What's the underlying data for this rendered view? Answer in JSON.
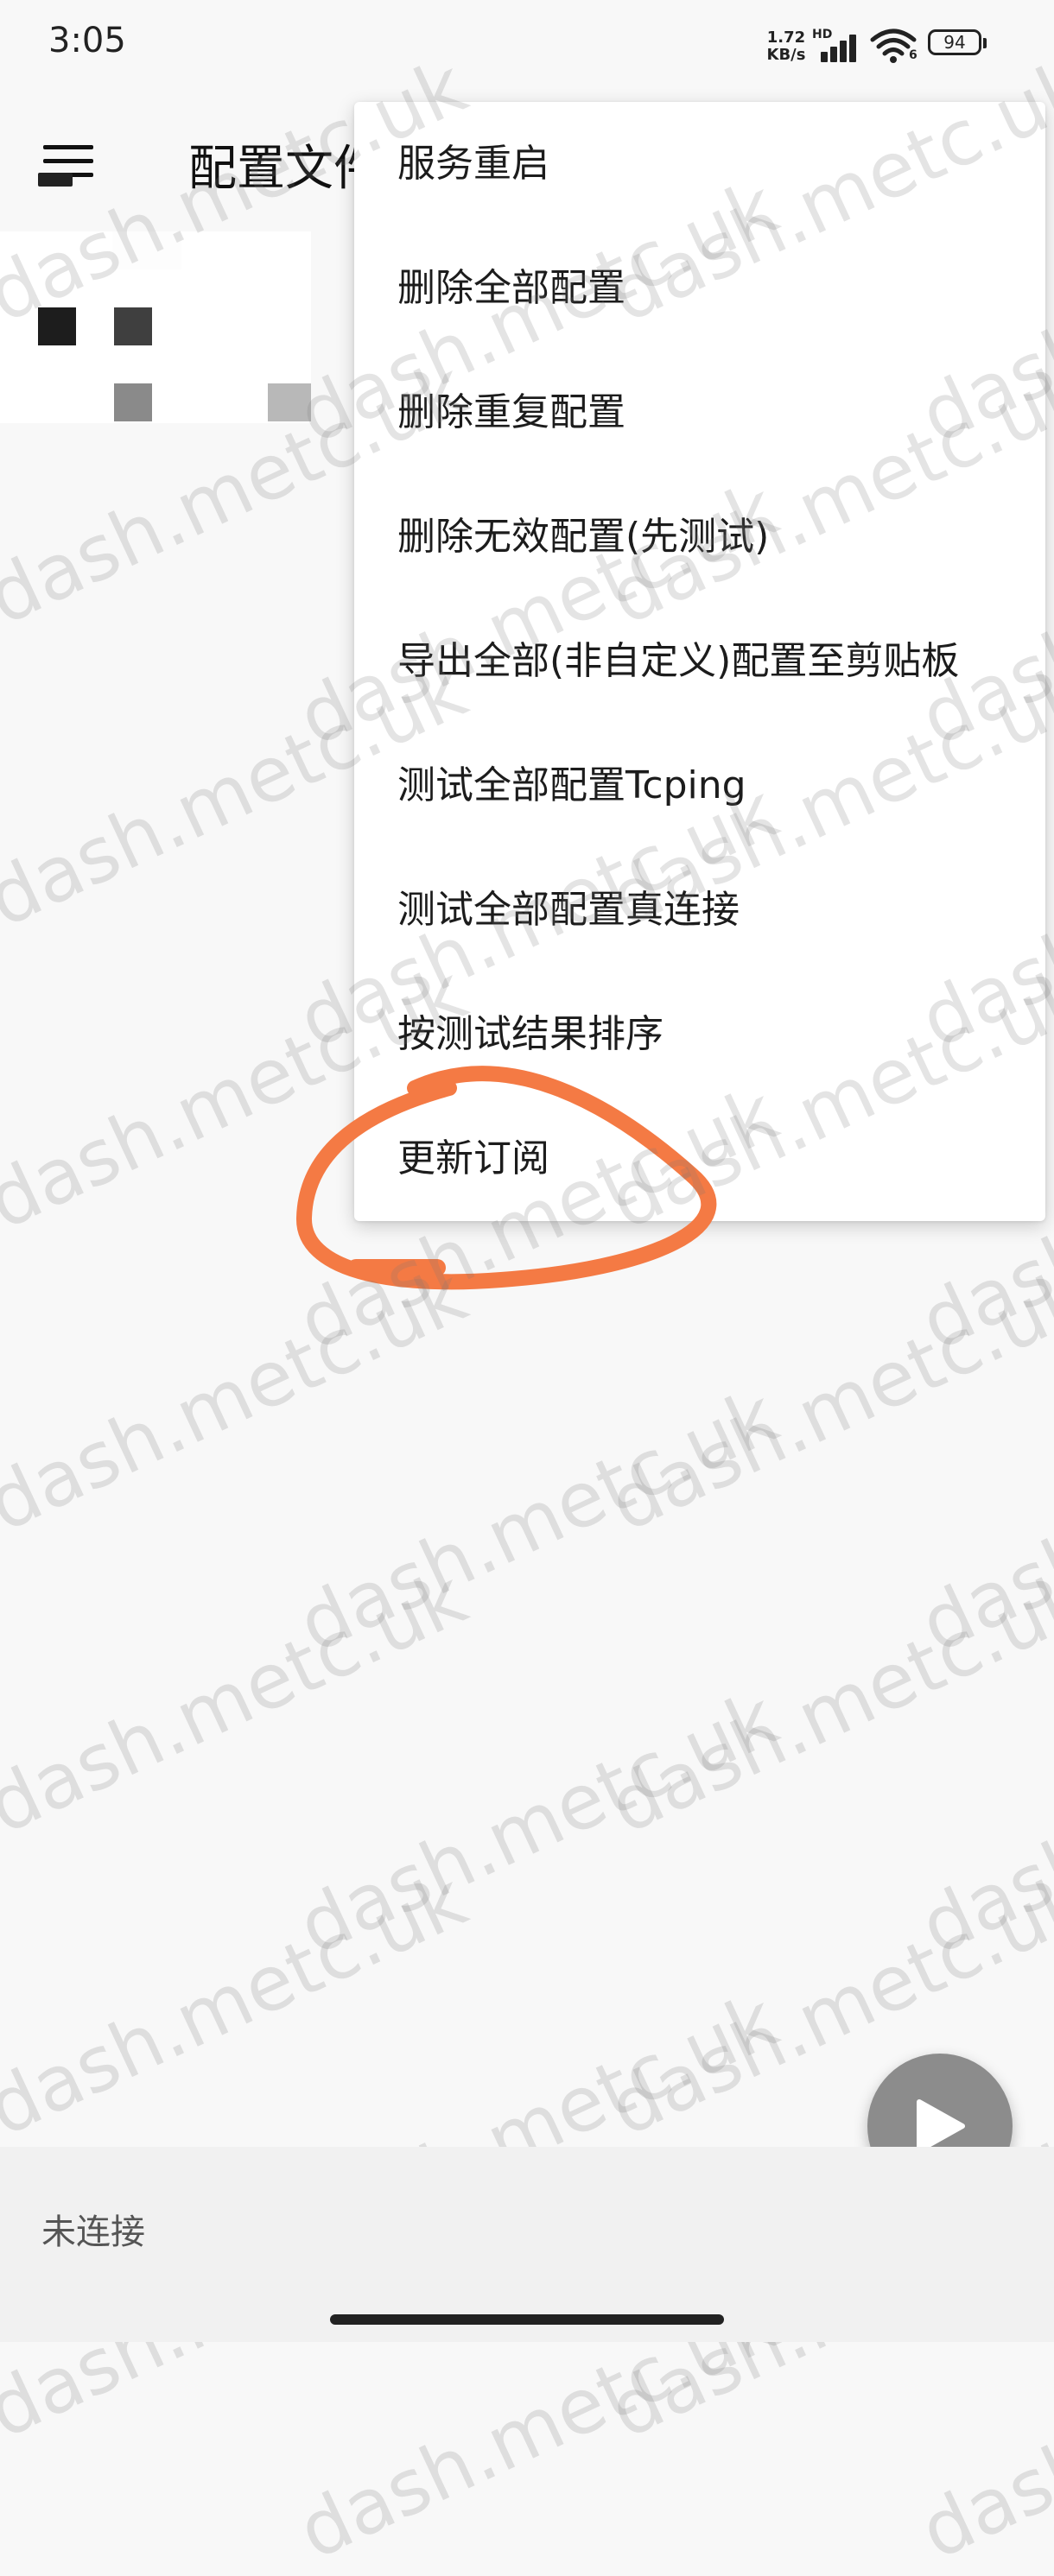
{
  "status_bar": {
    "time": "3:05",
    "net_speed_value": "1.72",
    "net_speed_unit": "KB/s",
    "network_type": "HD",
    "wifi_band": "6",
    "battery_level": "94"
  },
  "app_bar": {
    "title": "配置文件"
  },
  "menu": {
    "items": [
      {
        "label": "服务重启"
      },
      {
        "label": "删除全部配置"
      },
      {
        "label": "删除重复配置"
      },
      {
        "label": "删除无效配置(先测试)"
      },
      {
        "label": "导出全部(非自定义)配置至剪贴板"
      },
      {
        "label": "测试全部配置Tcping"
      },
      {
        "label": "测试全部配置真连接"
      },
      {
        "label": "按测试结果排序"
      },
      {
        "label": "更新订阅"
      }
    ]
  },
  "connection_status": "未连接",
  "watermark_text": "dash.metc.uk",
  "colors": {
    "annotation": "#f47a44",
    "fab": "#8c8c8c",
    "background": "#f8f8f8"
  },
  "icons": {
    "menu": "hamburger-menu-icon",
    "fab": "play-icon"
  }
}
